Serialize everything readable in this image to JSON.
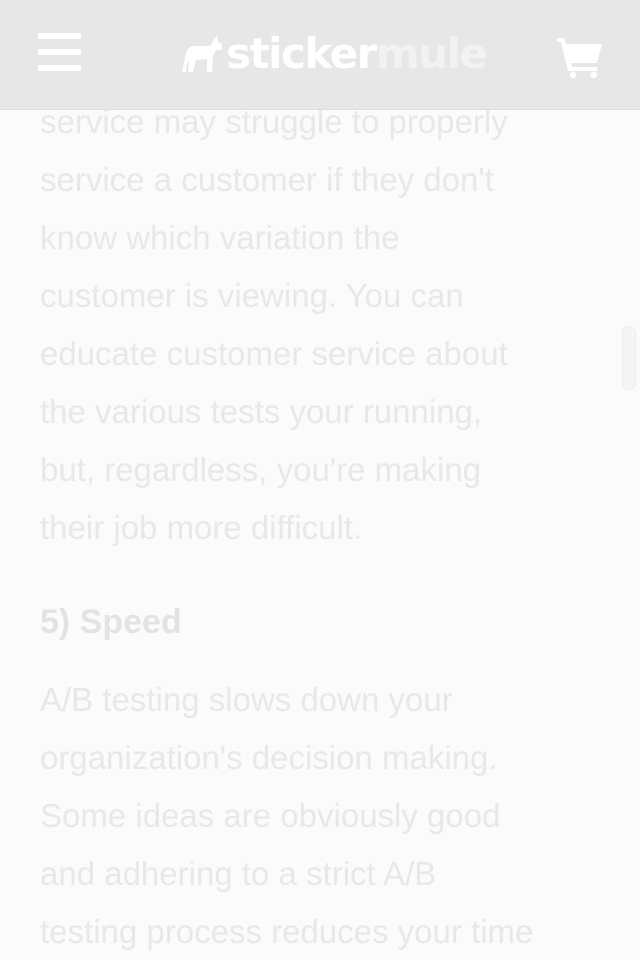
{
  "header": {
    "logo": {
      "word1": "sticker",
      "word2": "mule"
    },
    "menu_icon": "hamburger-menu-icon",
    "cart_icon": "shopping-cart-icon"
  },
  "article": {
    "paragraph1_lines": [
      "service may struggle to properly",
      "service a customer if they don't",
      "know which variation the",
      "customer is viewing. You can",
      "educate customer service about",
      "the various tests your running,",
      "but, regardless, you're making",
      "their job more difficult."
    ],
    "heading": "5) Speed",
    "paragraph2_lines": [
      "A/B testing slows down your",
      "organization's decision making.",
      "Some ideas are obviously good",
      "and adhering to a strict A/B",
      "testing process reduces your time"
    ]
  },
  "colors": {
    "header_bg": "#e7e7e7",
    "page_bg": "#fbfbfb",
    "text": "#e8e8e8"
  }
}
